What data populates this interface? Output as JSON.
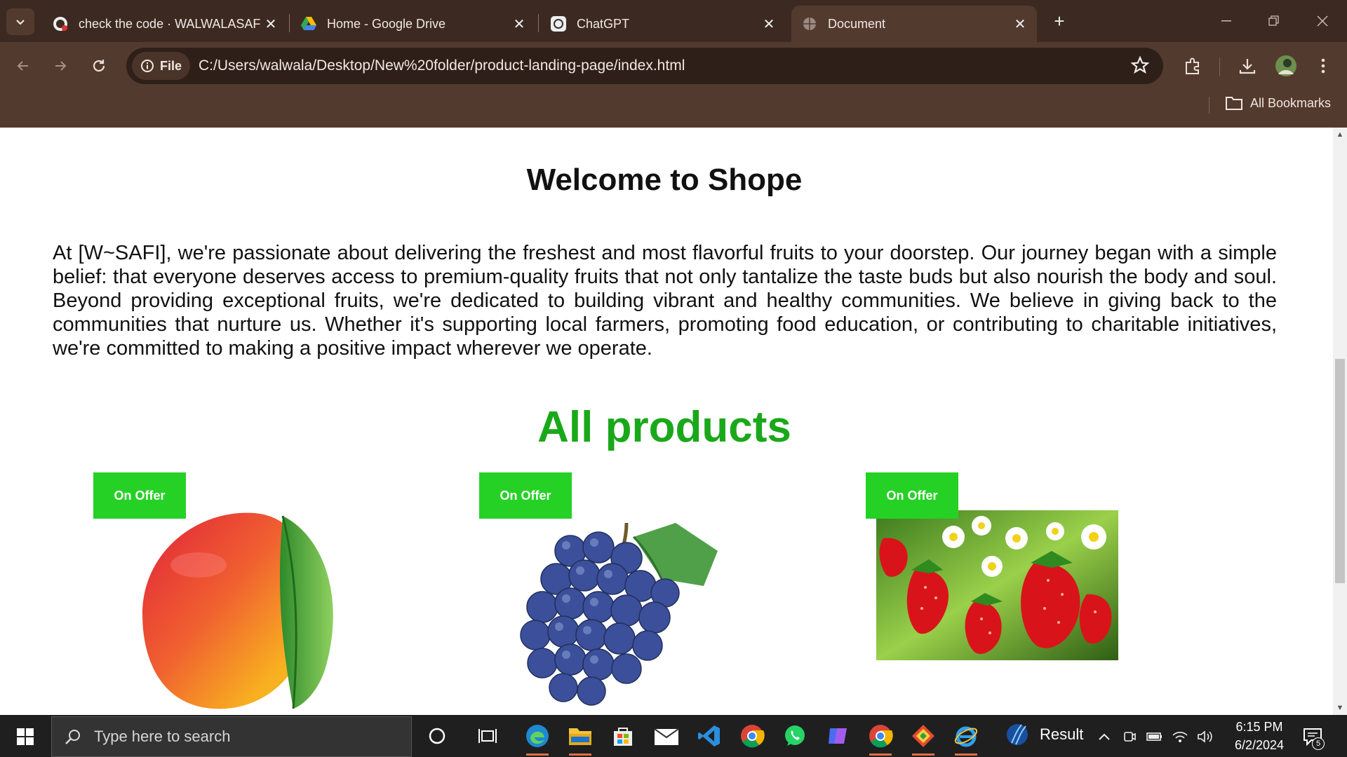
{
  "browser": {
    "tabs": [
      {
        "title": "check the code · WALWALASAFI",
        "favicon": "github-icon",
        "active": false
      },
      {
        "title": "Home - Google Drive",
        "favicon": "google-drive-icon",
        "active": false
      },
      {
        "title": "ChatGPT",
        "favicon": "chatgpt-icon",
        "active": false
      },
      {
        "title": "Document",
        "favicon": "globe-icon",
        "active": true
      }
    ],
    "address": {
      "chip_label": "File",
      "url": "C:/Users/walwala/Desktop/New%20folder/product-landing-page/index.html"
    },
    "bookmarks_label": "All Bookmarks",
    "theme_color": "#533a2e"
  },
  "page": {
    "welcome_heading": "Welcome to Shope",
    "intro_text": "At [W~SAFI], we're passionate about delivering the freshest and most flavorful fruits to your doorstep. Our journey began with a simple belief: that everyone deserves access to premium-quality fruits that not only tantalize the taste buds but also nourish the body and soul. Beyond providing exceptional fruits, we're dedicated to building vibrant and healthy communities. We believe in giving back to the communities that nurture us. Whether it's supporting local farmers, promoting food education, or contributing to charitable initiatives, we're committed to making a positive impact wherever we operate.",
    "products_heading": "All products",
    "products_heading_color": "#1aa81a",
    "badge_color": "#26d126",
    "products": [
      {
        "badge": "On Offer",
        "image": "mango-image"
      },
      {
        "badge": "On Offer",
        "image": "grapes-image"
      },
      {
        "badge": "On Offer",
        "image": "strawberries-image"
      }
    ]
  },
  "taskbar": {
    "search_placeholder": "Type here to search",
    "weather_label": "Result",
    "time": "6:15 PM",
    "date": "6/2/2024",
    "notification_count": "5"
  }
}
